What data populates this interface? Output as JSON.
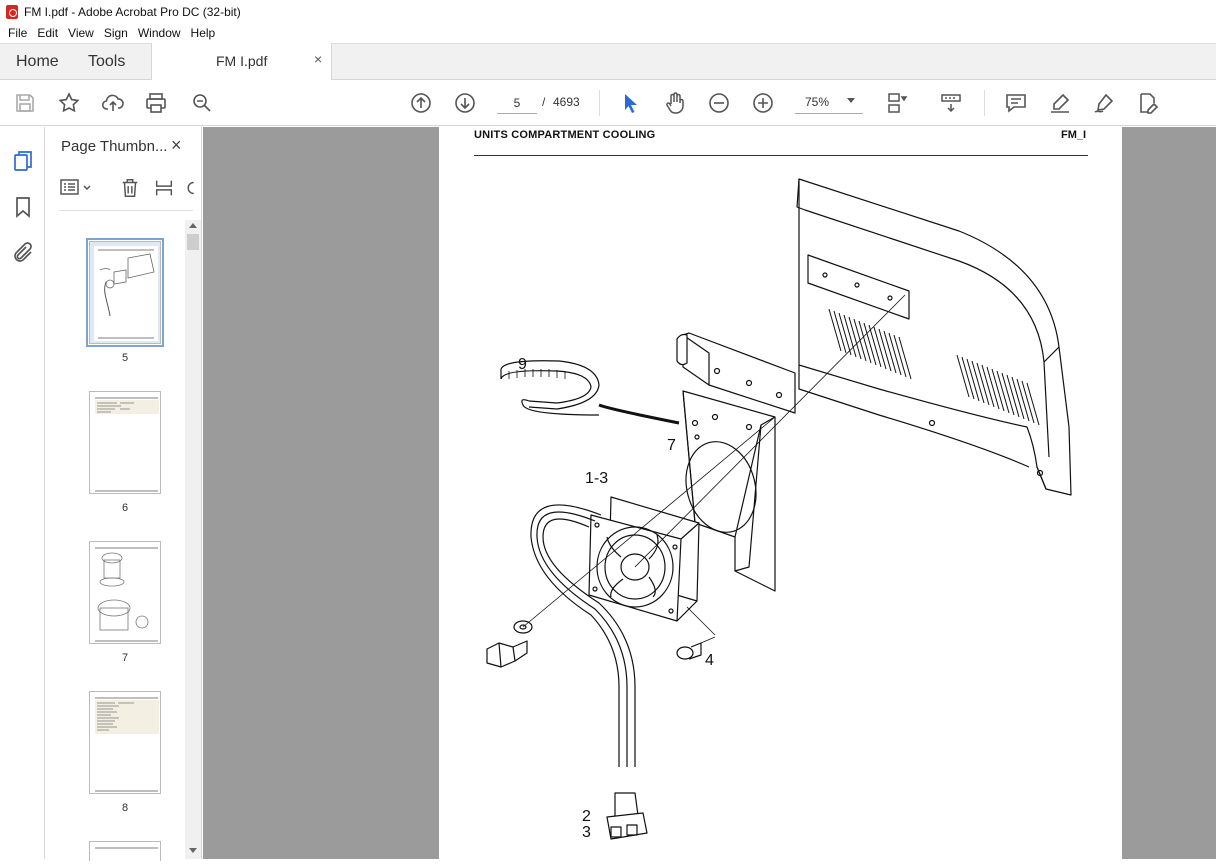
{
  "window": {
    "title": "FM I.pdf - Adobe Acrobat Pro DC (32-bit)"
  },
  "menu": [
    "File",
    "Edit",
    "View",
    "Sign",
    "Window",
    "Help"
  ],
  "tabs": {
    "home": "Home",
    "tools": "Tools",
    "document": "FM I.pdf",
    "close": "×"
  },
  "toolbar": {
    "page_current": "5",
    "page_separator": "/",
    "page_total": "4693",
    "zoom": "75%"
  },
  "thumbnails": {
    "panel_title": "Page Thumbn...",
    "close": "×",
    "pages": [
      {
        "label": "5",
        "selected": true
      },
      {
        "label": "6",
        "selected": false
      },
      {
        "label": "7",
        "selected": false
      },
      {
        "label": "8",
        "selected": false
      }
    ]
  },
  "document": {
    "header_left": "UNITS COMPARTMENT COOLING",
    "header_right": "FM_I",
    "callouts": {
      "c9": "9",
      "c7": "7",
      "c13": "1-3",
      "c4": "4",
      "c2": "2",
      "c3": "3"
    }
  }
}
